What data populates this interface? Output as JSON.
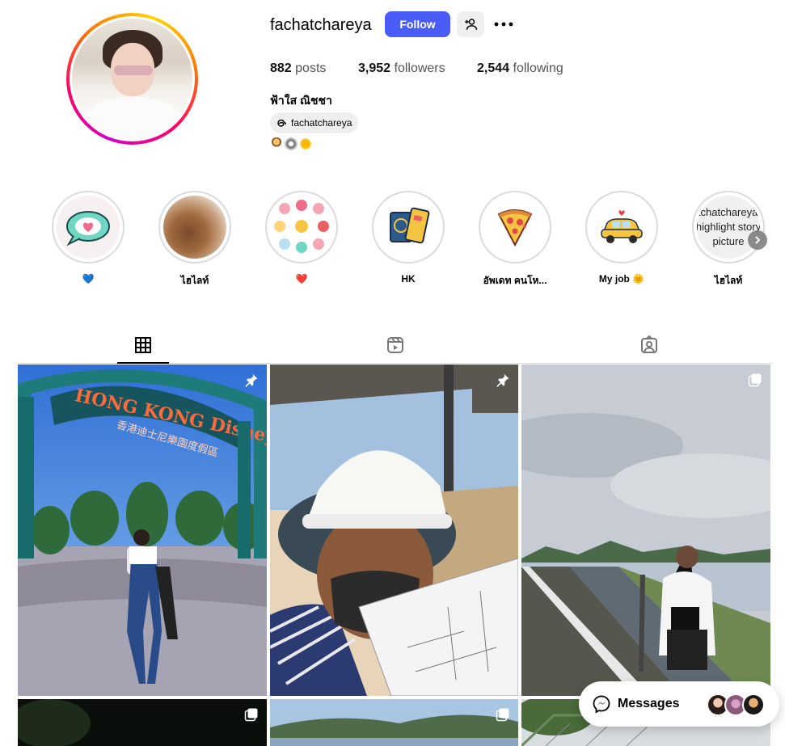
{
  "profile": {
    "username": "fachatchareya",
    "follow_label": "Follow",
    "posts_count": "882",
    "posts_label": "posts",
    "followers_count": "3,952",
    "followers_label": "followers",
    "following_count": "2,544",
    "following_label": "following",
    "full_name": "ฟ้าใส ณิชชา",
    "threads_handle": "fachatchareya",
    "bio_emojis": [
      "person-emoji",
      "gear-emoji",
      "sun-emoji"
    ]
  },
  "highlights": [
    {
      "label": "💙",
      "icon": "speech-heart-icon"
    },
    {
      "label": "ไฮไลท์",
      "icon": "food-photo"
    },
    {
      "label": "❤️",
      "icon": "travel-collage-icon"
    },
    {
      "label": "HK",
      "icon": "passport-icon"
    },
    {
      "label": "อัพเดท คนโห...",
      "icon": "pizza-icon"
    },
    {
      "label": "My job 🌞",
      "icon": "car-icon"
    },
    {
      "label": "ไฮไลท์",
      "icon": "broken-image",
      "alt_text": "fachatchareya's highlight story picture"
    }
  ],
  "tabs": [
    "posts-grid",
    "reels",
    "tagged"
  ],
  "posts": [
    {
      "scene": "disneyland",
      "sign": "HONG KONG Disneyland Resort",
      "sign_sub": "香港迪士尼樂園度假區",
      "badge": "pin-icon"
    },
    {
      "scene": "hardhat",
      "badge": "pin-icon"
    },
    {
      "scene": "lakeside-road",
      "badge": "carousel-icon"
    },
    {
      "scene": "night",
      "badge": "carousel-icon"
    },
    {
      "scene": "lake",
      "badge": "carousel-icon"
    },
    {
      "scene": "fence",
      "badge": ""
    }
  ],
  "messages": {
    "label": "Messages"
  },
  "colors": {
    "follow": "#4a5df9",
    "ring_start": "#d300c5",
    "ring_end": "#ffd600"
  }
}
